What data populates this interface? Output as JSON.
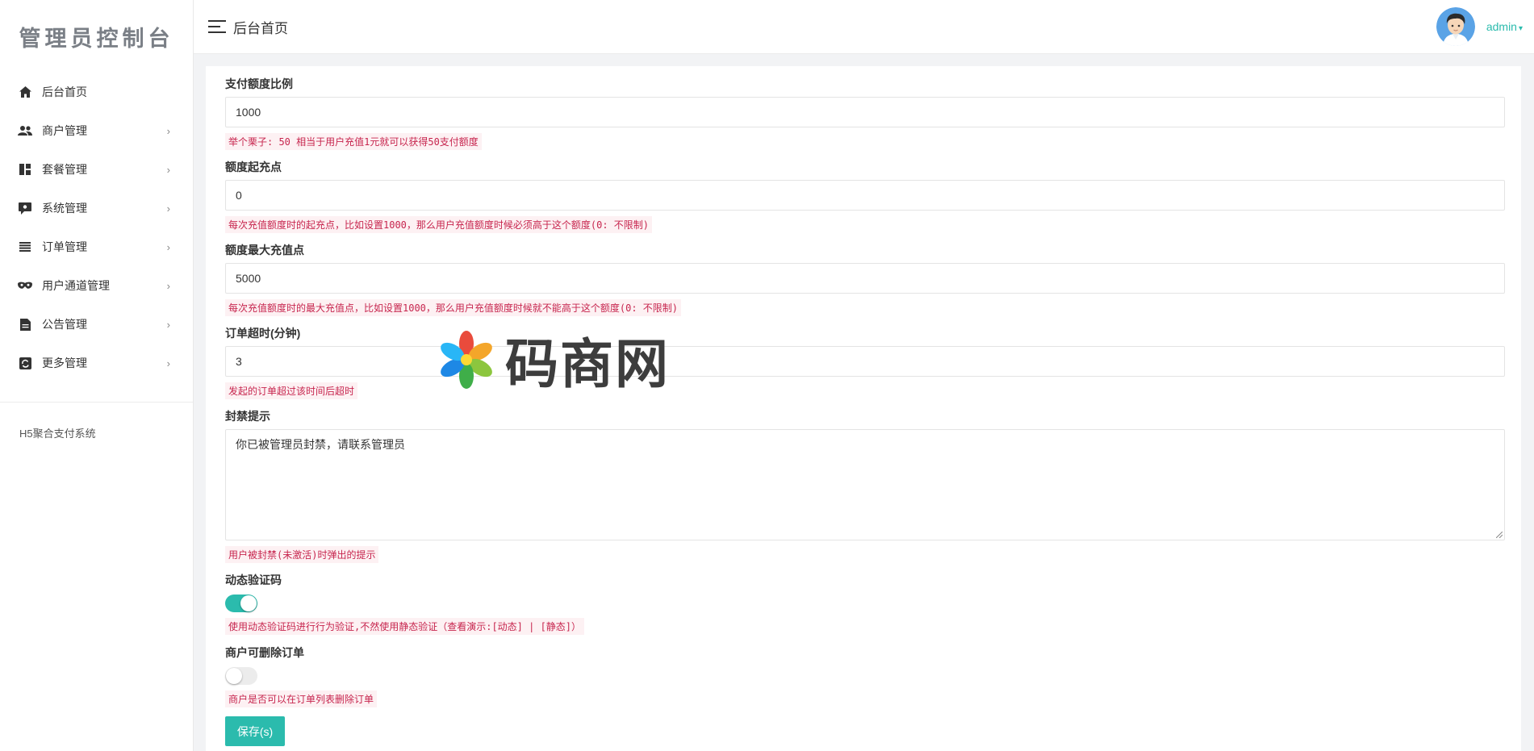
{
  "sidebar": {
    "brand": "管理员控制台",
    "items": [
      {
        "label": "后台首页",
        "icon": "home-icon",
        "has_children": false
      },
      {
        "label": "商户管理",
        "icon": "users-icon",
        "has_children": true
      },
      {
        "label": "套餐管理",
        "icon": "dashboard-icon",
        "has_children": true
      },
      {
        "label": "系统管理",
        "icon": "settings-icon",
        "has_children": true
      },
      {
        "label": "订单管理",
        "icon": "list-icon",
        "has_children": true
      },
      {
        "label": "用户通道管理",
        "icon": "mask-icon",
        "has_children": true
      },
      {
        "label": "公告管理",
        "icon": "document-icon",
        "has_children": true
      },
      {
        "label": "更多管理",
        "icon": "refresh-icon",
        "has_children": true
      }
    ],
    "chevron": "›",
    "system_name": "H5聚合支付系统"
  },
  "header": {
    "title": "后台首页",
    "username": "admin",
    "caret": "▾"
  },
  "form": {
    "ratio": {
      "label": "支付额度比例",
      "value": "1000",
      "hint": "举个栗子: 50 相当于用户充值1元就可以获得50支付额度"
    },
    "min_point": {
      "label": "额度起充点",
      "value": "0",
      "hint": "每次充值额度时的起充点，比如设置1000，那么用户充值额度时候必须高于这个额度(0: 不限制)"
    },
    "max_point": {
      "label": "额度最大充值点",
      "value": "5000",
      "hint": "每次充值额度时的最大充值点，比如设置1000，那么用户充值额度时候就不能高于这个额度(0: 不限制)"
    },
    "timeout": {
      "label": "订单超时(分钟)",
      "value": "3",
      "hint": "发起的订单超过该时间后超时"
    },
    "ban_tip": {
      "label": "封禁提示",
      "value": "你已被管理员封禁，请联系管理员",
      "hint": "用户被封禁(未激活)时弹出的提示"
    },
    "captcha": {
      "label": "动态验证码",
      "enabled": true,
      "hint": "使用动态验证码进行行为验证,不然使用静态验证（查看演示:[动态] | [静态]）"
    },
    "delete_order": {
      "label": "商户可删除订单",
      "enabled": false,
      "hint": "商户是否可以在订单列表删除订单"
    },
    "save_label": "保存(s)"
  },
  "watermark": {
    "text": "码商网"
  },
  "colors": {
    "accent": "#2bbbad",
    "hint_text": "#c7254e",
    "hint_bg": "#fdf1f3"
  }
}
